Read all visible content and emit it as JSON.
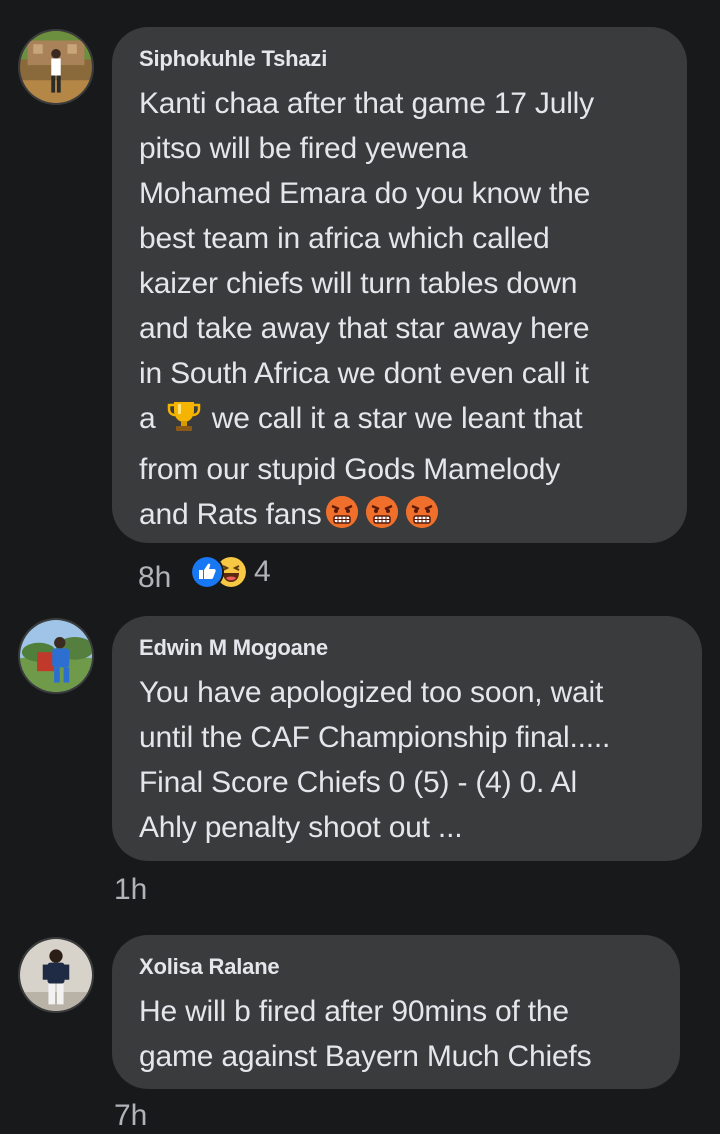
{
  "comments": [
    {
      "author": "Siphokuhle Tshazi",
      "text_lines": [
        "Kanti chaa after that game 17 Jully",
        "pitso will be fired yewena",
        "Mohamed Emara do you know the",
        "best team in africa which called",
        "kaizer chiefs will turn tables down",
        "and take away that star away here",
        "in South Africa we dont even call it"
      ],
      "line_trophy_before": "a",
      "line_trophy_after": "we call it a star we leant that",
      "line_9": "from our stupid Gods Mamelody",
      "line_10": "and Rats fans",
      "time": "8h",
      "reaction_count": "4"
    },
    {
      "author": "Edwin M Mogoane",
      "text_lines": [
        "You have apologized too soon, wait",
        "until the CAF Championship final.....",
        "Final Score Chiefs 0 (5) - (4) 0. Al",
        "Ahly penalty shoot out ..."
      ],
      "time": "1h"
    },
    {
      "author": "Xolisa Ralane",
      "text_lines": [
        "He will b fired after 90mins of the",
        "game against Bayern Much Chiefs"
      ],
      "time": "7h"
    }
  ],
  "icons": {
    "trophy": "trophy-emoji",
    "angry": "angry-face-emoji",
    "like": "like-reaction-icon",
    "haha": "haha-reaction-icon"
  },
  "colors": {
    "background": "#18191a",
    "bubble": "#3a3b3c",
    "text": "#e4e6eb",
    "meta": "#b0b3b8",
    "like_blue": "#1877f2"
  }
}
